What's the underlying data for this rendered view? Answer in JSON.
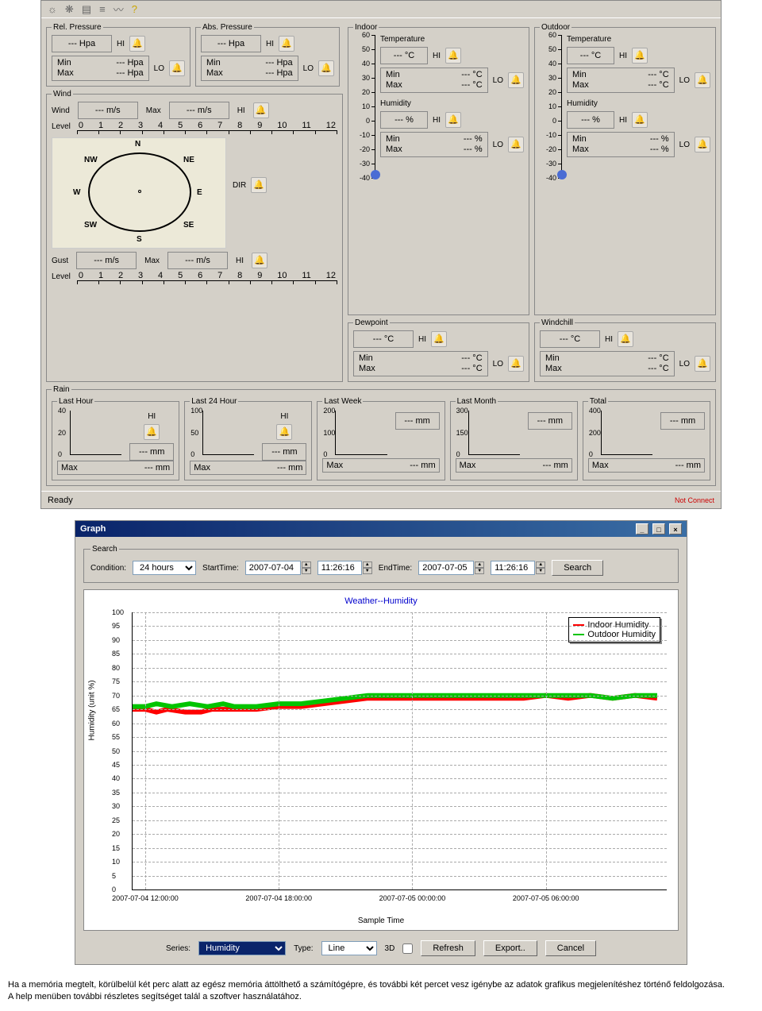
{
  "toolbar_icons": [
    "icon1",
    "icon2",
    "icon3",
    "icon4",
    "icon5",
    "help"
  ],
  "pressure": {
    "rel": {
      "title": "Rel. Pressure",
      "value": "--- Hpa",
      "min_label": "Min",
      "min": "--- Hpa",
      "max_label": "Max",
      "max": "--- Hpa",
      "hi": "HI",
      "lo": "LO"
    },
    "abs": {
      "title": "Abs. Pressure",
      "value": "--- Hpa",
      "min_label": "Min",
      "min": "--- Hpa",
      "max_label": "Max",
      "max": "--- Hpa",
      "hi": "HI",
      "lo": "LO"
    }
  },
  "wind": {
    "title": "Wind",
    "wind_label": "Wind",
    "wind_val": "--- m/s",
    "wind_max_label": "Max",
    "wind_max": "--- m/s",
    "level_label": "Level",
    "scale": [
      "0",
      "1",
      "2",
      "3",
      "4",
      "5",
      "6",
      "7",
      "8",
      "9",
      "10",
      "11",
      "12"
    ],
    "compass": {
      "N": "N",
      "NE": "NE",
      "E": "E",
      "SE": "SE",
      "S": "S",
      "SW": "SW",
      "W": "W",
      "NW": "NW"
    },
    "dir_label": "DIR",
    "gust_label": "Gust",
    "gust_val": "--- m/s",
    "gust_max": "--- m/s",
    "hi": "HI"
  },
  "indoor": {
    "title": "Indoor",
    "temp_label": "Temperature",
    "temp": "--- °C",
    "hum_label": "Humidity",
    "hum": "--- %",
    "min_label": "Min",
    "max_label": "Max",
    "tmin": "--- °C",
    "tmax": "--- °C",
    "hmin": "--- %",
    "hmax": "--- %",
    "hi": "HI",
    "lo": "LO",
    "scale": [
      "60",
      "50",
      "40",
      "30",
      "20",
      "10",
      "0",
      "-10",
      "-20",
      "-30",
      "-40"
    ]
  },
  "outdoor": {
    "title": "Outdoor",
    "temp_label": "Temperature",
    "temp": "--- °C",
    "hum_label": "Humidity",
    "hum": "--- %",
    "min_label": "Min",
    "max_label": "Max",
    "tmin": "--- °C",
    "tmax": "--- °C",
    "hmin": "--- %",
    "hmax": "--- %",
    "hi": "HI",
    "lo": "LO",
    "scale": [
      "60",
      "50",
      "40",
      "30",
      "20",
      "10",
      "0",
      "-10",
      "-20",
      "-30",
      "-40"
    ]
  },
  "dewpoint": {
    "title": "Dewpoint",
    "val": "--- °C",
    "min_label": "Min",
    "min": "--- °C",
    "max_label": "Max",
    "max": "--- °C",
    "hi": "HI",
    "lo": "LO"
  },
  "windchill": {
    "title": "Windchill",
    "val": "--- °C",
    "min_label": "Min",
    "min": "--- °C",
    "max_label": "Max",
    "max": "--- °C",
    "hi": "HI",
    "lo": "LO"
  },
  "rain": {
    "title": "Rain",
    "cols": {
      "lasthour": {
        "title": "Last Hour",
        "scale": [
          "40",
          "20",
          "0"
        ],
        "val": "--- mm",
        "max_label": "Max",
        "max": "--- mm",
        "hi": "HI"
      },
      "last24": {
        "title": "Last 24 Hour",
        "scale": [
          "100",
          "50",
          "0"
        ],
        "val": "--- mm",
        "max_label": "Max",
        "max": "--- mm",
        "hi": "HI"
      },
      "lastweek": {
        "title": "Last Week",
        "scale": [
          "200",
          "100",
          "0"
        ],
        "val": "--- mm",
        "max_label": "Max",
        "max": "--- mm"
      },
      "lastmonth": {
        "title": "Last Month",
        "scale": [
          "300",
          "150",
          "0"
        ],
        "val": "--- mm",
        "max_label": "Max",
        "max": "--- mm"
      },
      "total": {
        "title": "Total",
        "scale": [
          "400",
          "200",
          "0"
        ],
        "val": "--- mm",
        "max_label": "Max",
        "max": "--- mm"
      }
    }
  },
  "status": {
    "text": "Ready",
    "connect": "Not Connect"
  },
  "graph_window": {
    "title": "Graph",
    "search": {
      "legend": "Search",
      "cond_label": "Condition:",
      "cond_value": "24 hours",
      "start_label": "StartTime:",
      "start_date": "2007-07-04",
      "start_time": "11:26:16",
      "end_label": "EndTime:",
      "end_date": "2007-07-05",
      "end_time": "11:26:16",
      "button": "Search"
    },
    "series_label": "Series:",
    "series_value": "Humidity",
    "type_label": "Type:",
    "type_value": "Line",
    "threeD": "3D",
    "refresh": "Refresh",
    "export": "Export..",
    "cancel": "Cancel"
  },
  "chart_data": {
    "type": "line",
    "title": "Weather--Humidity",
    "xlabel": "Sample Time",
    "ylabel": "Humidity (unit %)",
    "ylim": [
      0,
      100
    ],
    "y_ticks": [
      0,
      5,
      10,
      15,
      20,
      25,
      30,
      35,
      40,
      45,
      50,
      55,
      60,
      65,
      70,
      75,
      80,
      85,
      90,
      95,
      100
    ],
    "x_ticks": [
      "2007-07-04 12:00:00",
      "2007-07-04 18:00:00",
      "2007-07-05 00:00:00",
      "2007-07-05 06:00:00"
    ],
    "x_range_hours": [
      11.43,
      35.43
    ],
    "legend": [
      "Indoor Humidity",
      "Outdoor Humidity"
    ],
    "colors": {
      "Indoor Humidity": "#ff0000",
      "Outdoor Humidity": "#00c400"
    },
    "series": [
      {
        "name": "Indoor Humidity",
        "x_hours": [
          11.43,
          12,
          12.5,
          13,
          13.8,
          14.5,
          15,
          16,
          17,
          18,
          19,
          20,
          21,
          22,
          23,
          24,
          25,
          26,
          27,
          28,
          29,
          30,
          31,
          32,
          33,
          34,
          35
        ],
        "y": [
          65,
          65,
          64,
          65,
          64,
          64,
          65,
          65,
          65,
          66,
          66,
          67,
          68,
          69,
          69,
          69,
          69,
          69,
          69,
          69,
          69,
          70,
          69,
          70,
          69,
          70,
          69
        ]
      },
      {
        "name": "Outdoor Humidity",
        "x_hours": [
          11.43,
          12,
          12.5,
          13.2,
          14,
          14.8,
          15.5,
          16,
          17,
          18,
          19,
          20,
          21,
          22,
          23,
          24,
          25,
          26,
          27,
          28,
          29,
          30,
          31,
          32,
          33,
          34,
          35
        ],
        "y": [
          66,
          66,
          67,
          66,
          67,
          66,
          67,
          66,
          66,
          67,
          67,
          68,
          69,
          70,
          70,
          70,
          70,
          70,
          70,
          70,
          70,
          70,
          70,
          70,
          69,
          70,
          70
        ]
      }
    ]
  },
  "doc": {
    "p1": "Ha a memória megtelt, körülbelül két perc alatt az egész memória áttölthető a számítógépre, és további két percet vesz igénybe az adatok grafikus megjelenítéshez történő feldolgozása.",
    "p2": "A help menüben további részletes segítséget talál a szoftver használatához."
  }
}
